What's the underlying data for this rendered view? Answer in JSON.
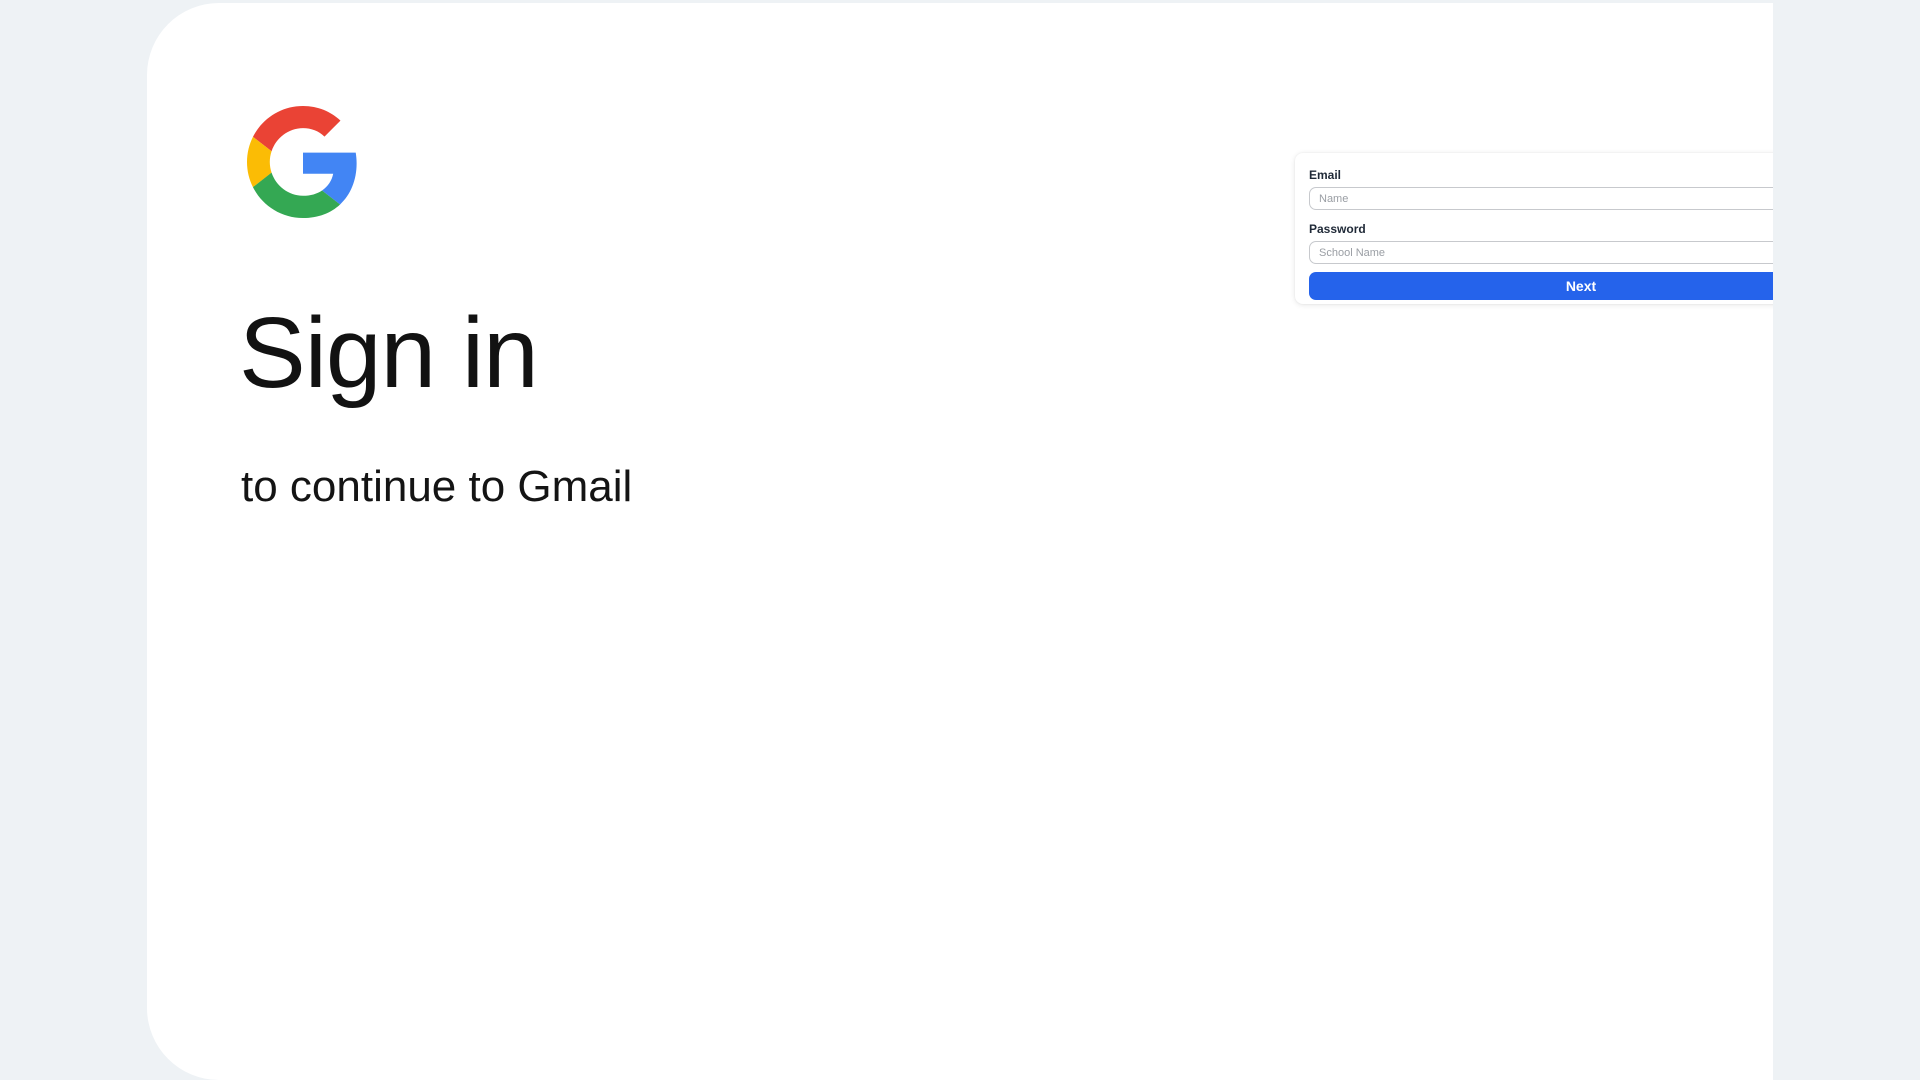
{
  "heading": {
    "title": "Sign in",
    "subtitle": "to continue to Gmail"
  },
  "logo": {
    "icon": "google-g-logo",
    "colors": {
      "red": "#EA4335",
      "yellow": "#FBBC05",
      "green": "#34A853",
      "blue": "#4285F4"
    }
  },
  "form": {
    "email_label": "Email",
    "email_placeholder": "Name",
    "password_label": "Password",
    "password_placeholder": "School Name",
    "next_label": "Next",
    "button_color": "#2563EB"
  }
}
